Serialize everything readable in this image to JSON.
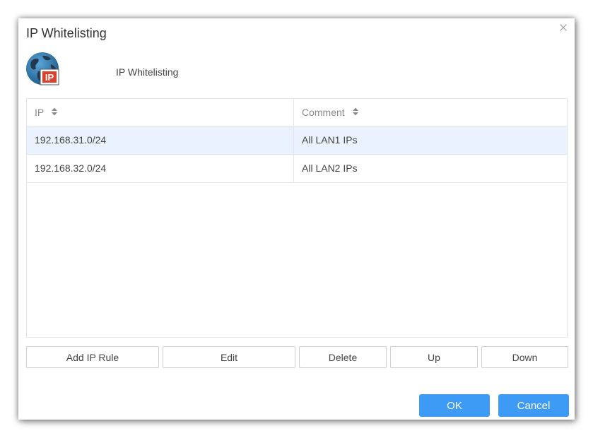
{
  "dialog": {
    "title": "IP Whitelisting",
    "subtitle": "IP Whitelisting",
    "logo_text": "IP"
  },
  "table": {
    "columns": [
      {
        "label": "IP"
      },
      {
        "label": "Comment"
      }
    ],
    "rows": [
      {
        "ip": "192.168.31.0/24",
        "comment": "All LAN1 IPs",
        "selected": true
      },
      {
        "ip": "192.168.32.0/24",
        "comment": "All LAN2 IPs",
        "selected": false
      }
    ]
  },
  "actions": {
    "add": "Add IP Rule",
    "edit": "Edit",
    "delete": "Delete",
    "up": "Up",
    "down": "Down"
  },
  "footer": {
    "ok": "OK",
    "cancel": "Cancel"
  },
  "colors": {
    "primary": "#3e9bf5",
    "selected_row": "#eaf3fd",
    "logo_badge": "#d9412d"
  },
  "icons": [
    "close-icon",
    "ip-globe-logo",
    "sort-icon"
  ]
}
